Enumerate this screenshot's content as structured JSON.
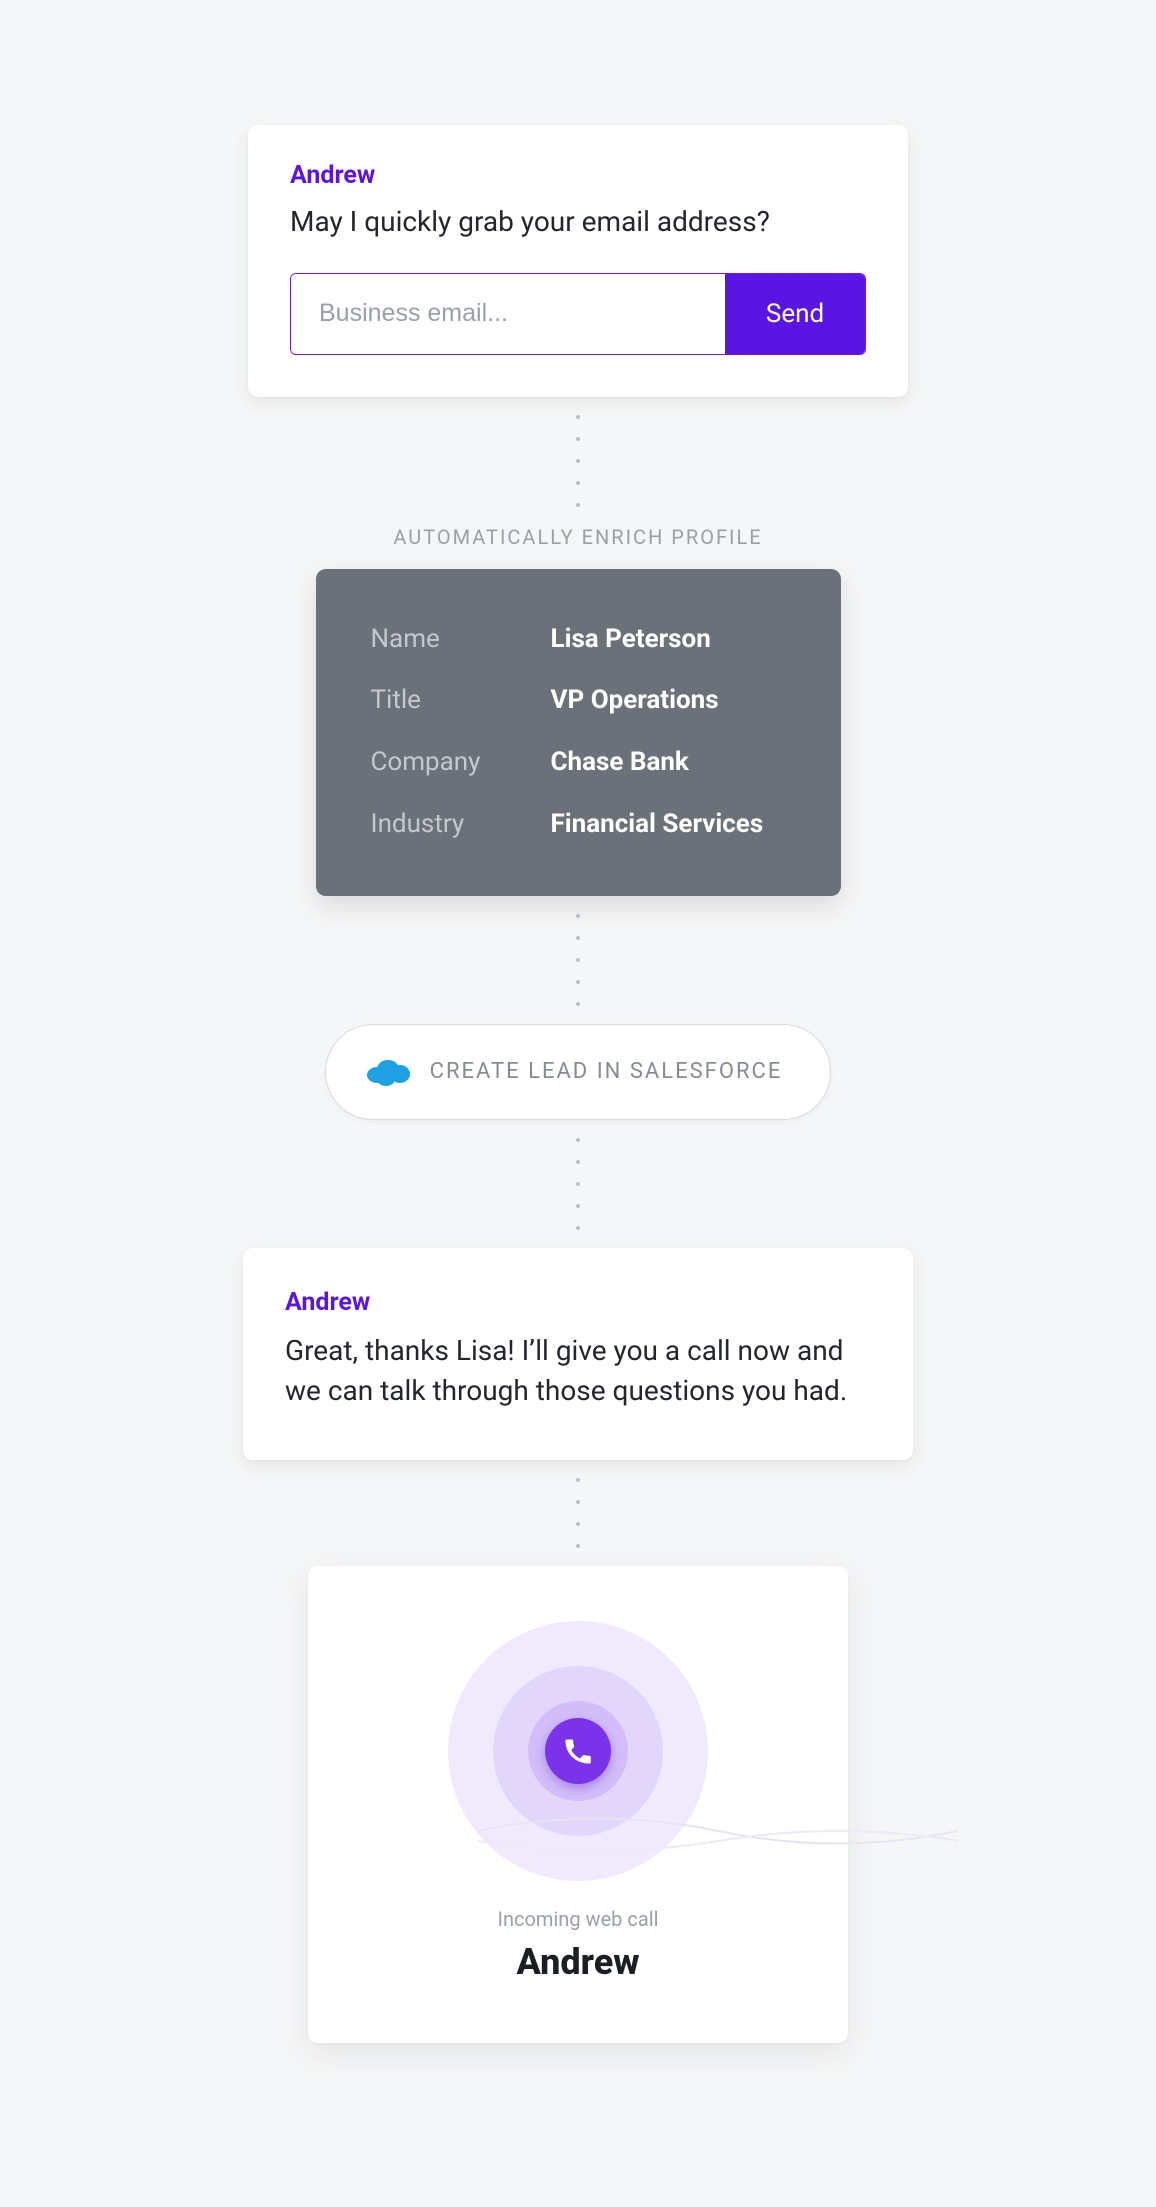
{
  "chat1": {
    "sender": "Andrew",
    "message": "May I quickly grab your email address?",
    "email_placeholder": "Business email...",
    "send_label": "Send"
  },
  "enrich": {
    "label": "AUTOMATICALLY ENRICH PROFILE",
    "rows": {
      "name_label": "Name",
      "name_value": "Lisa Peterson",
      "title_label": "Title",
      "title_value": "VP Operations",
      "company_label": "Company",
      "company_value": "Chase Bank",
      "industry_label": "Industry",
      "industry_value": "Financial Services"
    }
  },
  "salesforce": {
    "label": "CREATE LEAD IN SALESFORCE"
  },
  "chat2": {
    "sender": "Andrew",
    "message": "Great, thanks Lisa! I’ll give you a call now and we can talk through those questions you had."
  },
  "call": {
    "incoming_label": "Incoming web call",
    "caller": "Andrew"
  }
}
